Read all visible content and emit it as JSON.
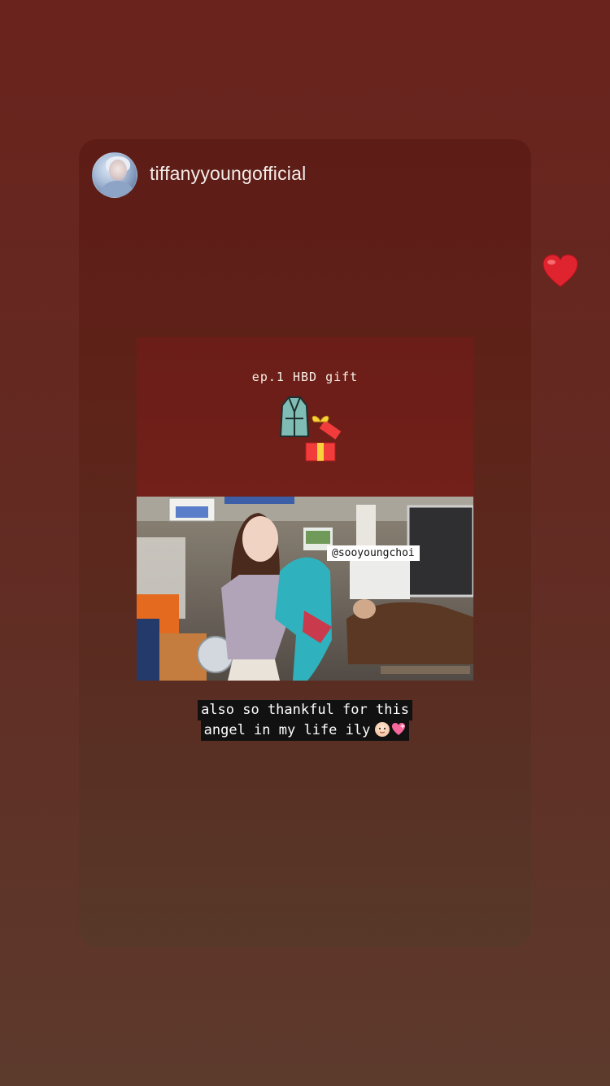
{
  "story": {
    "username": "tiffanyyoungofficial",
    "reaction_icon": "red-heart-icon"
  },
  "post": {
    "title": "ep.1 HBD gift",
    "icons": [
      "robe-icon",
      "gift-box-icon"
    ],
    "photo_mention": "@sooyoungchoi",
    "caption_line1": "also so thankful for this",
    "caption_line2": "angel in my life ily",
    "caption_emojis": [
      "baby-face-icon",
      "sparkling-heart-icon"
    ]
  },
  "colors": {
    "background_top": "#6a231d",
    "background_bottom": "#5c3a2c",
    "post_panel": "#6b1d18",
    "heart": "#e0242f"
  }
}
